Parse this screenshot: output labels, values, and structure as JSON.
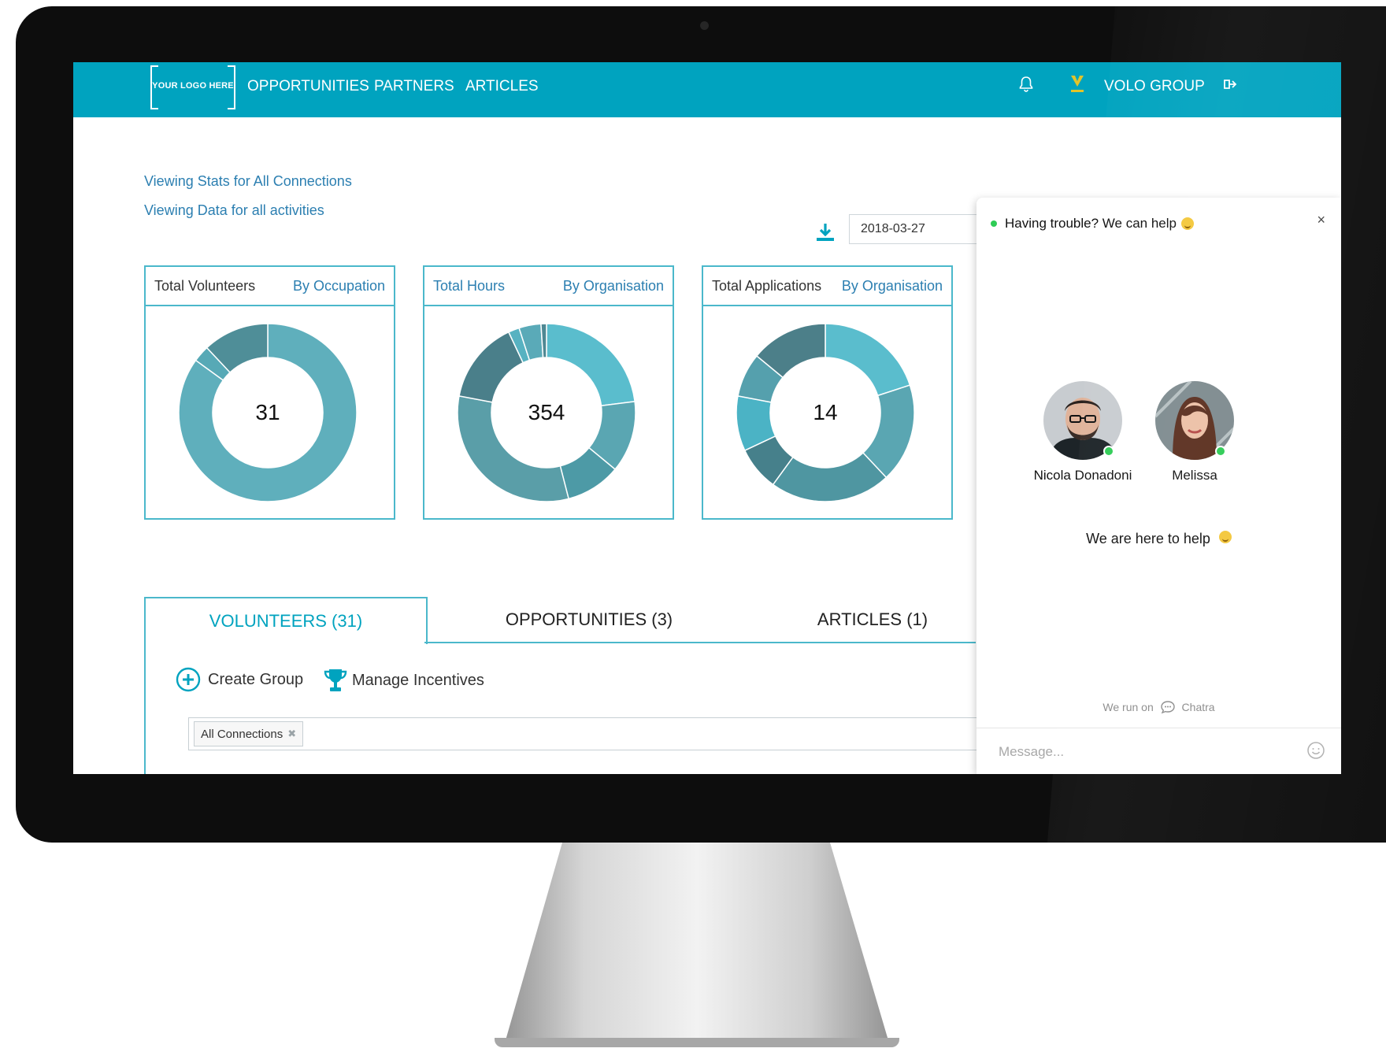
{
  "nav": {
    "logo_text": "YOUR LOGO HERE",
    "links": [
      "OPPORTUNITIES",
      "PARTNERS",
      "ARTICLES"
    ],
    "org_name": "VOLO GROUP",
    "brand_color": "#00a3bf"
  },
  "header": {
    "stats_scope": "Viewing Stats for All Connections",
    "data_scope": "Viewing Data for all activities",
    "date_value": "2018-03-27"
  },
  "cards": [
    {
      "title": "Total Volunteers",
      "link": "By Occupation",
      "value": "31",
      "segments": [
        0.85,
        0.03,
        0.12
      ],
      "colors": [
        "#5fafbc",
        "#57a9b6",
        "#4f8e98"
      ]
    },
    {
      "title": "Total Hours",
      "link": "By Organisation",
      "value": "354",
      "segments": [
        0.23,
        0.13,
        0.1,
        0.32,
        0.15,
        0.02,
        0.04,
        0.01
      ],
      "colors": [
        "#5abdcd",
        "#5aa6b2",
        "#4d9aa6",
        "#5a9ea8",
        "#4a7f8a",
        "#57b2c1",
        "#5aaab8",
        "#4f8893"
      ]
    },
    {
      "title": "Total Applications",
      "link": "By Organisation",
      "value": "14",
      "segments": [
        0.2,
        0.18,
        0.22,
        0.08,
        0.1,
        0.08,
        0.14
      ],
      "colors": [
        "#5abdcd",
        "#5aa6b2",
        "#4f96a1",
        "#46808b",
        "#4bb3c5",
        "#55a0ad",
        "#4c7f89"
      ]
    }
  ],
  "tabs": [
    {
      "label": "VOLUNTEERS (31)",
      "active": true
    },
    {
      "label": "OPPORTUNITIES (3)",
      "active": false
    },
    {
      "label": "ARTICLES (1)",
      "active": false
    }
  ],
  "actions": {
    "create_group": "Create Group",
    "manage_incentives": "Manage Incentives"
  },
  "filter": {
    "tag": "All Connections"
  },
  "chat": {
    "status": "Having trouble? We can help",
    "close": "×",
    "agents": [
      "Nicola Donadoni",
      "Melissa"
    ],
    "help_text": "We are here to help",
    "powered_prefix": "We run on",
    "powered_brand": "Chatra",
    "input_placeholder": "Message..."
  }
}
